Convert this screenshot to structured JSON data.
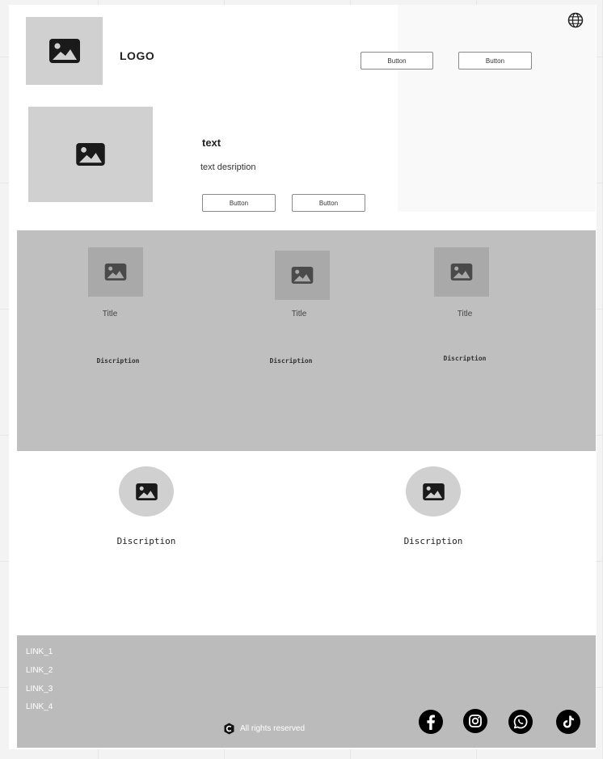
{
  "header": {
    "logo_text": "LOGO",
    "button_1_label": "Button",
    "button_2_label": "Button",
    "globe_icon": "globe-icon"
  },
  "hero": {
    "title": "text",
    "description": "text desription",
    "button_1_label": "Button",
    "button_2_label": "Button"
  },
  "cards": [
    {
      "title": "Title",
      "description": "Discription"
    },
    {
      "title": "Title",
      "description": "Discription"
    },
    {
      "title": "Title",
      "description": "Discription"
    }
  ],
  "features": [
    {
      "description": "Discription"
    },
    {
      "description": "Discription"
    }
  ],
  "footer": {
    "links": [
      "LINK_1",
      "LINK_2",
      "LINK_3",
      "LINK_4"
    ],
    "copyright": "All rights reserved",
    "social_icons": [
      "facebook-icon",
      "instagram-icon",
      "whatsapp-icon",
      "tiktok-icon"
    ]
  },
  "colors": {
    "placeholder": "#d0d0d0",
    "band": "#bfbfbf",
    "footer": "#bbbbbb",
    "icon": "#1a1a1a"
  }
}
